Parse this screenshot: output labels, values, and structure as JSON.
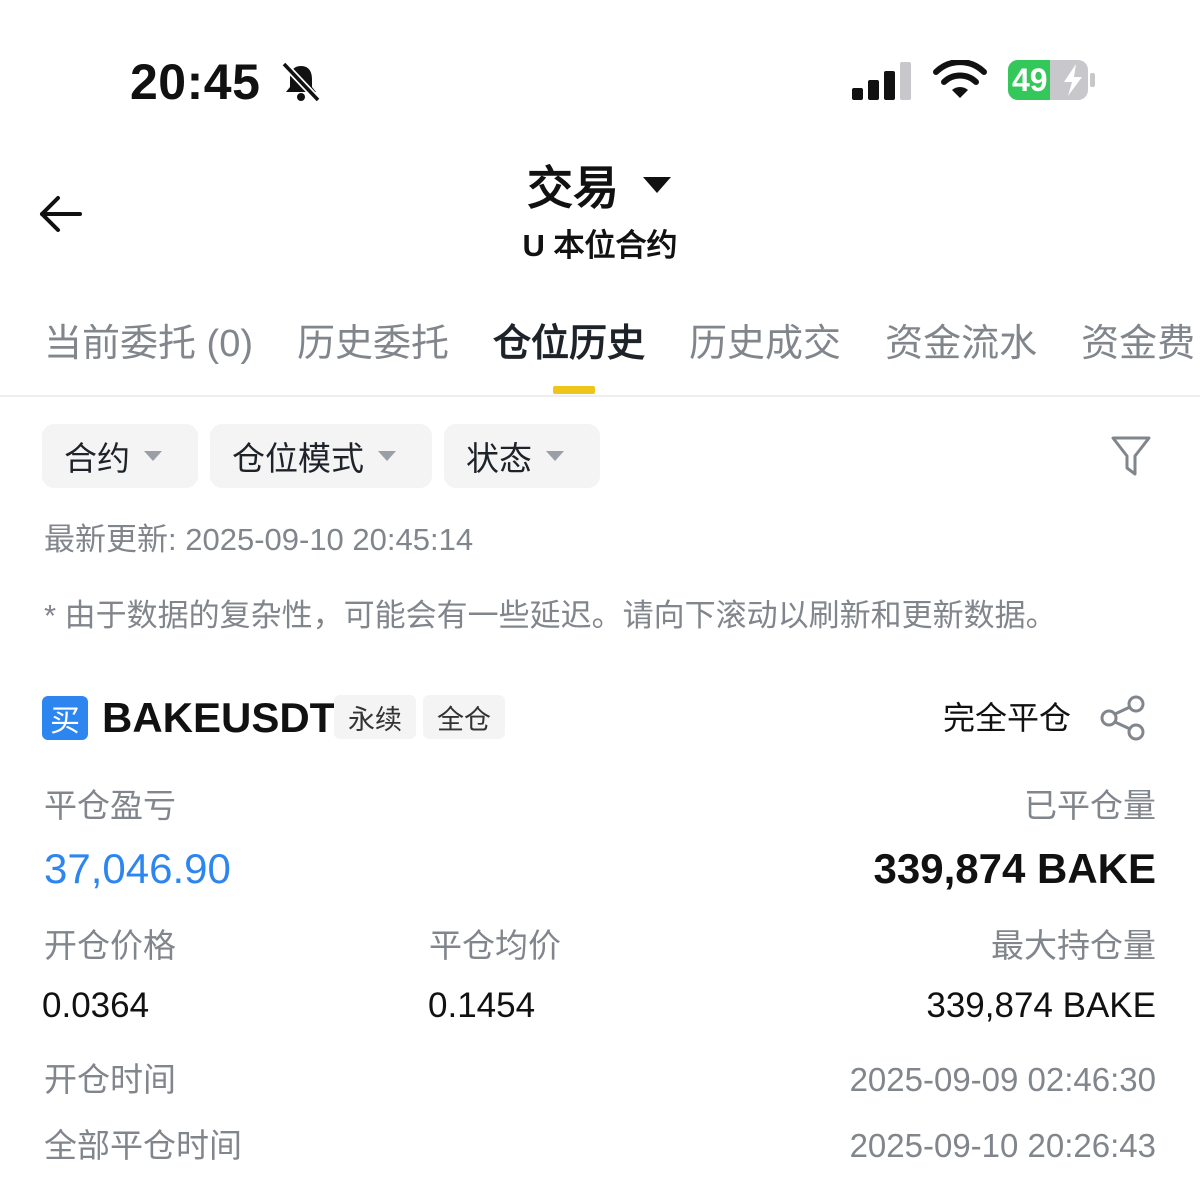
{
  "status_bar": {
    "time": "20:45",
    "battery": "49"
  },
  "header": {
    "title": "交易",
    "subtitle": "U 本位合约"
  },
  "tabs": [
    {
      "label": "当前委托 (0)"
    },
    {
      "label": "历史委托"
    },
    {
      "label": "仓位历史"
    },
    {
      "label": "历史成交"
    },
    {
      "label": "资金流水"
    },
    {
      "label": "资金费"
    }
  ],
  "active_tab": 2,
  "filters": {
    "contract": "合约",
    "position_mode": "仓位模式",
    "status": "状态"
  },
  "info": {
    "updated": "最新更新: 2025-09-10 20:45:14",
    "note": "* 由于数据的复杂性，可能会有一些延迟。请向下滚动以刷新和更新数据。"
  },
  "position": {
    "side": "买",
    "symbol": "BAKEUSDT",
    "tag_perpetual": "永续",
    "tag_margin": "全仓",
    "status": "完全平仓",
    "pnl_label": "平仓盈亏",
    "pnl_value": "37,046.90",
    "closed_qty_label": "已平仓量",
    "closed_qty_value": "339,874 BAKE",
    "open_price_label": "开仓价格",
    "open_price_value": "0.0364",
    "avg_close_label": "平仓均价",
    "avg_close_value": "0.1454",
    "max_pos_label": "最大持仓量",
    "max_pos_value": "339,874 BAKE",
    "open_time_label": "开仓时间",
    "open_time_value": "2025-09-09 02:46:30",
    "close_time_label": "全部平仓时间",
    "close_time_value": "2025-09-10 20:26:43"
  },
  "icons": {
    "bell": "bell-slash-icon",
    "signal": "cellular-signal-icon",
    "wifi": "wifi-icon",
    "battery": "battery-charging-icon",
    "back": "arrow-left-icon",
    "filter": "funnel-icon",
    "share": "share-icon"
  },
  "colors": {
    "accent_blue": "#2d86f0",
    "tab_indicator": "#f0c51a",
    "battery_green": "#34c759",
    "muted_text": "#81858c"
  }
}
